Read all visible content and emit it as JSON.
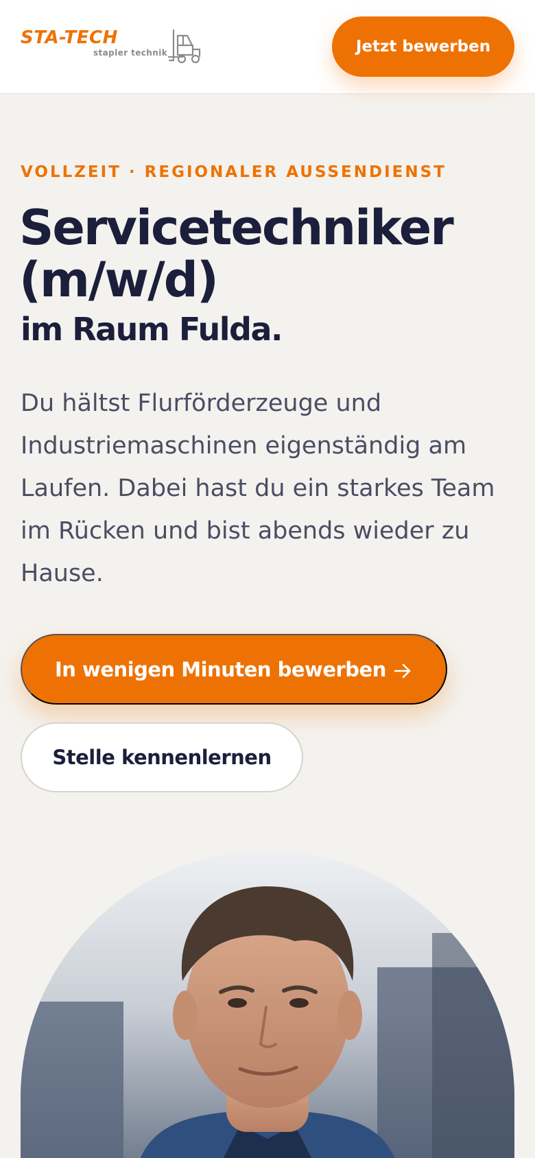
{
  "header": {
    "logo": {
      "word": "STA-TECH",
      "sub": "stapler technik",
      "brand_color": "#ee7203"
    },
    "cta_label": "Jetzt bewerben"
  },
  "hero": {
    "eyebrow": "VOLLZEIT · REGIONALER AUSSENDIENST",
    "title_line1": "Servicetechniker",
    "title_line2": "(m/w/d)",
    "subtitle": "im Raum Fulda.",
    "description": "Du hältst Flurförderzeuge und Industriemaschinen eigenständig am Laufen. Dabei hast du ein starkes Team im Rücken und bist abends wieder zu Hause.",
    "primary_button": "In wenigen Minuten bewerben",
    "primary_icon": "arrow-right-icon",
    "secondary_button": "Stelle kennenlernen"
  },
  "colors": {
    "accent": "#ee7203",
    "navy": "#1b1f3b",
    "background": "#f4f2ee"
  }
}
